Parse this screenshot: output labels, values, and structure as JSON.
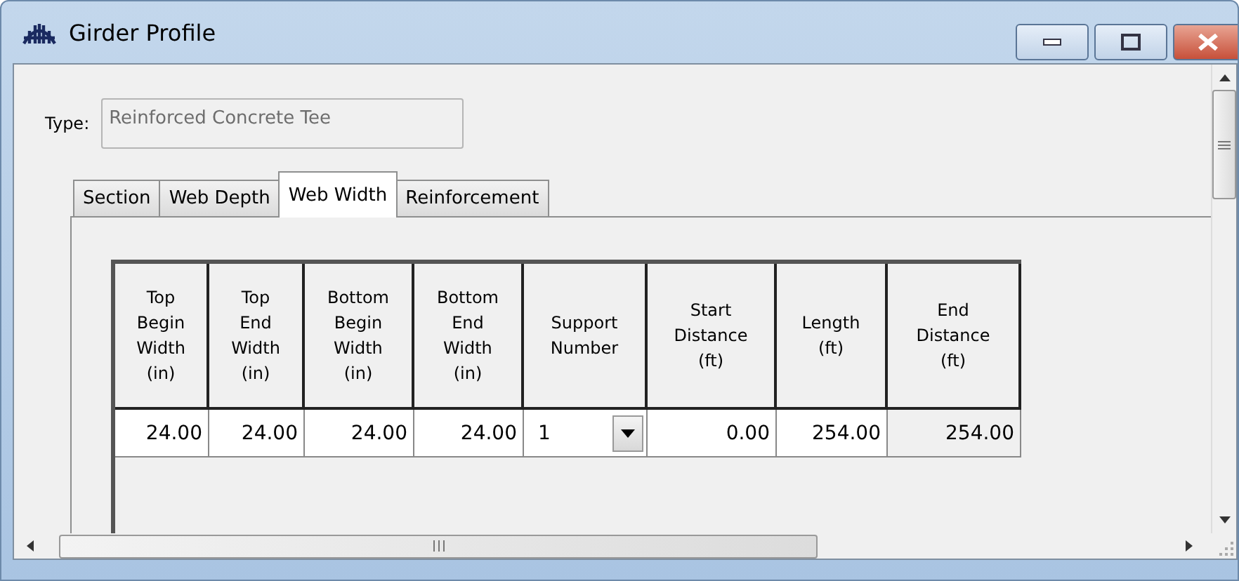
{
  "window": {
    "title": "Girder Profile"
  },
  "type_field": {
    "label": "Type:",
    "value": "Reinforced Concrete Tee",
    "disabled": true
  },
  "tabs": [
    {
      "label": "Section",
      "selected": false
    },
    {
      "label": "Web Depth",
      "selected": false
    },
    {
      "label": "Web Width",
      "selected": true
    },
    {
      "label": "Reinforcement",
      "selected": false
    }
  ],
  "table": {
    "columns": [
      "Top\nBegin\nWidth\n(in)",
      "Top\nEnd\nWidth\n(in)",
      "Bottom\nBegin\nWidth\n(in)",
      "Bottom\nEnd\nWidth\n(in)",
      "Support\nNumber",
      "Start\nDistance\n(ft)",
      "Length\n(ft)",
      "End\nDistance\n(ft)"
    ],
    "rows": [
      [
        {
          "value": "24.00",
          "kind": "text"
        },
        {
          "value": "24.00",
          "kind": "text"
        },
        {
          "value": "24.00",
          "kind": "text"
        },
        {
          "value": "24.00",
          "kind": "text"
        },
        {
          "value": "1",
          "kind": "dropdown"
        },
        {
          "value": "0.00",
          "kind": "text"
        },
        {
          "value": "254.00",
          "kind": "text"
        },
        {
          "value": "254.00",
          "kind": "readonly"
        }
      ]
    ]
  }
}
